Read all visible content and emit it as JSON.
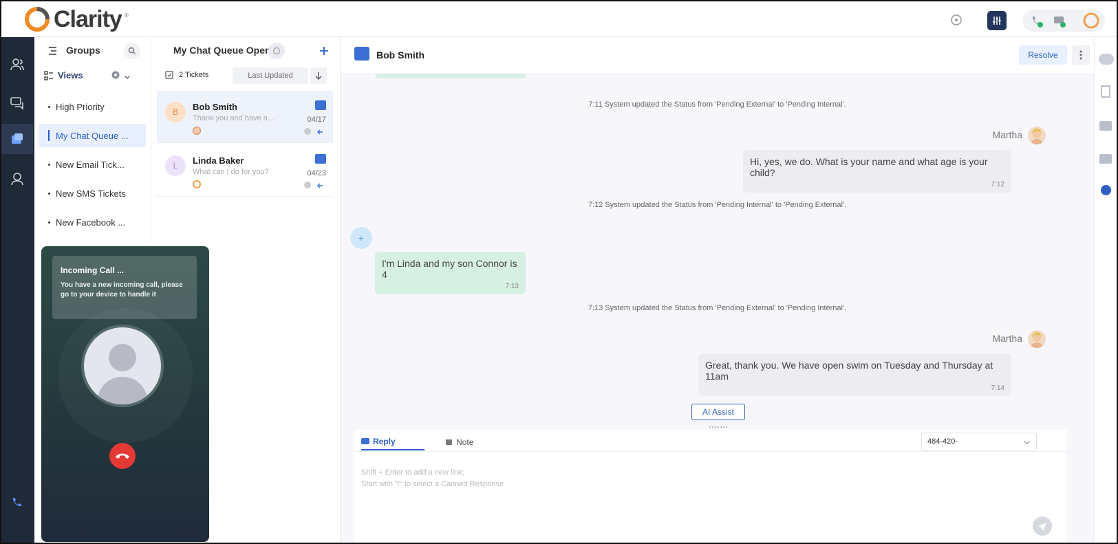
{
  "app": {
    "logo_text": "Clarity",
    "logo_tm": "®"
  },
  "topbar": {
    "icons": [
      "sync-icon",
      "equalizer-icon",
      "phone-status-icon",
      "chat-status-icon",
      "profile-ring-icon"
    ]
  },
  "leftnav": {
    "icons": [
      "contacts-icon",
      "chat-bubbles-icon",
      "ticket-queue-icon",
      "agent-icon",
      "phone-icon"
    ]
  },
  "groups": {
    "title": "Groups",
    "views_label": "Views",
    "items": [
      {
        "label": "High Priority"
      },
      {
        "label": "My Chat Queue ..."
      },
      {
        "label": "New Email Tick..."
      },
      {
        "label": "New SMS Tickets"
      },
      {
        "label": "New Facebook ..."
      }
    ]
  },
  "queue": {
    "title": "My Chat Queue Open",
    "count": "2 Tickets",
    "sort_label": "Last Updated",
    "tickets": [
      {
        "initial": "B",
        "name": "Bob Smith",
        "preview": "Thank you and have a ...",
        "date": "04/17"
      },
      {
        "initial": "L",
        "name": "Linda Baker",
        "preview": "What can I do for you?",
        "date": "04/23"
      }
    ]
  },
  "chat": {
    "contact_name": "Bob Smith",
    "resolve_label": "Resolve",
    "events": {
      "sys1": "7:11 System updated the Status from 'Pending External' to 'Pending Internal'.",
      "author1": "Martha",
      "msg1": "Hi, yes, we do. What is your name and what age is your child?",
      "time1": "7:12",
      "sys2": "7:12 System updated the Status from 'Pending Internal' to 'Pending External'.",
      "msg2": "I'm Linda and my son Connor is 4",
      "time2": "7:13",
      "sys3": "7:13 System updated the Status from 'Pending External' to 'Pending Internal'.",
      "author2": "Martha",
      "msg3": "Great, thank you. We have open swim on Tuesday and Thursday at 11am",
      "time3": "7:14"
    },
    "ai_assist_label": "AI Assist",
    "composer": {
      "reply_tab": "Reply",
      "note_tab": "Note",
      "phone_value": "484-420-",
      "placeholder_line1": "Shift + Enter to add a new line;",
      "placeholder_line2": "Start with \"/\" to select a Canned Response"
    }
  },
  "incoming_call": {
    "title": "Incoming Call ...",
    "message": "You have a new incoming call, please go to your device to handle it"
  },
  "rightbar": {
    "icons": [
      "salesforce-cloud-icon",
      "clipboard-icon",
      "contact-card-icon",
      "id-card-icon",
      "clock-icon"
    ]
  },
  "colors": {
    "accent": "#2f5ec4",
    "nav_bg": "#1f2937",
    "in_bubble": "#d6f0e4",
    "out_bubble": "#ececf1",
    "hangup": "#e53935"
  }
}
